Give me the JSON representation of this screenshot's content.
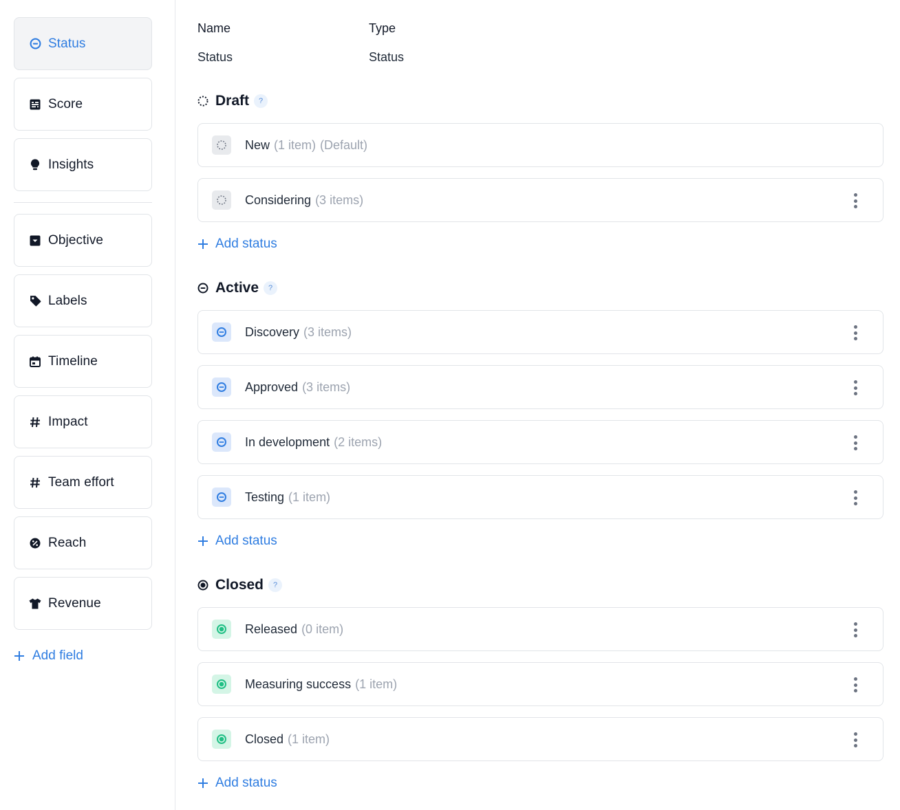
{
  "sidebar": {
    "fields": [
      {
        "label": "Status",
        "icon": "status-icon",
        "active": true
      },
      {
        "label": "Score",
        "icon": "score-icon"
      },
      {
        "label": "Insights",
        "icon": "lightbulb-icon"
      },
      {
        "label": "Objective",
        "icon": "objective-icon"
      },
      {
        "label": "Labels",
        "icon": "tag-icon"
      },
      {
        "label": "Timeline",
        "icon": "calendar-icon"
      },
      {
        "label": "Impact",
        "icon": "hash-icon"
      },
      {
        "label": "Team effort",
        "icon": "hash-icon"
      },
      {
        "label": "Reach",
        "icon": "percent-icon"
      },
      {
        "label": "Revenue",
        "icon": "shirt-icon"
      }
    ],
    "add_field_label": "Add field"
  },
  "header": {
    "name_label": "Name",
    "type_label": "Type",
    "name_value": "Status",
    "type_value": "Status"
  },
  "groups": [
    {
      "title": "Draft",
      "help": "?",
      "statuses": [
        {
          "name": "New",
          "count": "(1 item)",
          "default": "(Default)"
        },
        {
          "name": "Considering",
          "count": "(3 items)"
        }
      ],
      "add_label": "Add status"
    },
    {
      "title": "Active",
      "help": "?",
      "statuses": [
        {
          "name": "Discovery",
          "count": "(3 items)"
        },
        {
          "name": "Approved",
          "count": "(3 items)"
        },
        {
          "name": "In development",
          "count": "(2 items)"
        },
        {
          "name": "Testing",
          "count": "(1 item)"
        }
      ],
      "add_label": "Add status"
    },
    {
      "title": "Closed",
      "help": "?",
      "statuses": [
        {
          "name": "Released",
          "count": "(0 item)"
        },
        {
          "name": "Measuring success",
          "count": "(1 item)"
        },
        {
          "name": "Closed",
          "count": "(1 item)"
        }
      ],
      "add_label": "Add status"
    }
  ],
  "colors": {
    "accent": "#2f7de1",
    "active_status": "#2f7de1",
    "closed_status": "#1fbf84",
    "draft_status": "#6b7280"
  }
}
